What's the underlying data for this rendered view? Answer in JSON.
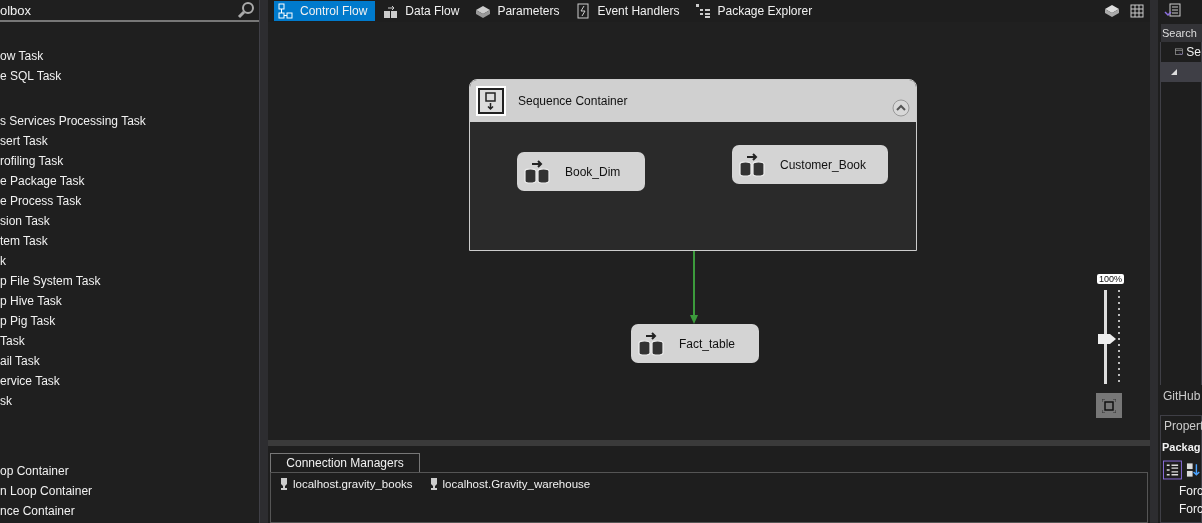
{
  "toolbox": {
    "title": "olbox",
    "groups": [
      {
        "items": [
          "ow Task",
          "e SQL Task"
        ]
      },
      {
        "items": [
          "s Services Processing Task",
          "sert Task",
          "rofiling Task",
          "e Package Task",
          "e Process Task",
          "sion Task",
          "tem Task",
          "k",
          "p File System Task",
          "p Hive Task",
          "p Pig Task",
          "Task",
          "ail Task",
          "ervice Task",
          "sk"
        ]
      },
      {
        "items": [
          "op Container",
          "n Loop Container",
          "nce Container"
        ]
      }
    ]
  },
  "designer_tabs": [
    {
      "label": "Control Flow",
      "selected": true
    },
    {
      "label": "Data Flow",
      "selected": false
    },
    {
      "label": "Parameters",
      "selected": false
    },
    {
      "label": "Event Handlers",
      "selected": false
    },
    {
      "label": "Package Explorer",
      "selected": false
    }
  ],
  "canvas": {
    "container": {
      "title": "Sequence Container",
      "expanded": true,
      "tasks": [
        {
          "label": "Book_Dim"
        },
        {
          "label": "Customer_Book"
        }
      ]
    },
    "tasks": [
      {
        "label": "Fact_table"
      }
    ],
    "zoom": {
      "reading": "100%",
      "level": 0.48
    }
  },
  "connection_managers": {
    "tab": "Connection Managers",
    "items": [
      "localhost.gravity_books",
      "localhost.Gravity_warehouse"
    ]
  },
  "right_panel": {
    "search": {
      "placeholder": "Search"
    },
    "tree_item": "Se",
    "github": "GitHub",
    "properties": {
      "title": "Propert",
      "object": "Packag",
      "rows": [
        "Forc",
        "Forc"
      ]
    }
  }
}
